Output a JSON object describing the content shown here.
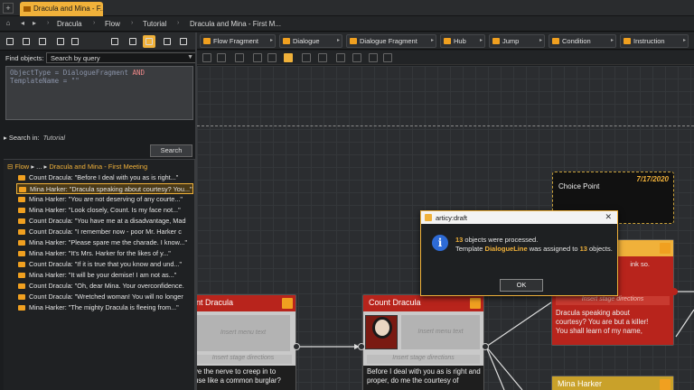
{
  "window_tab": {
    "title": "Dracula and Mina - F..."
  },
  "breadcrumb": [
    "Dracula",
    "Flow",
    "Tutorial",
    "Dracula and Mina - First M..."
  ],
  "search": {
    "find_label": "Find objects:",
    "query_type": "Search by query",
    "query_line1_a": "ObjectType = DialogueFragment ",
    "query_line1_b": "AND",
    "query_line2": "TemplateName = \"\"",
    "search_in_label": "Search in:",
    "search_in_value": "Tutorial",
    "search_button": "Search"
  },
  "results": {
    "path_a": "Flow",
    "path_b": "Dracula and Mina - First Meeting",
    "items": [
      "Count Dracula: \"Before I deal with you as is right...\"",
      "Mina Harker: \"Dracula speaking about courtesy? You...\"",
      "Mina Harker: \"You are not deserving of any courte...\"",
      "Mina Harker: \"Look closely, Count. Is my face not...\"",
      "Count Dracula: \"You have me at a disadvantage, Mad",
      "Count Dracula: \"I remember now - poor Mr. Harker c",
      "Mina Harker: \"Please spare me the charade. I know...\"",
      "Mina Harker: \"It's Mrs. Harker for the likes of y...\"",
      "Count Dracula: \"If it is true that you know and und...\"",
      "Mina Harker: \"It will be your demise! I am not as...\"",
      "Count Dracula: \"Oh, dear Mina. Your overconfidence.",
      "Count Dracula: \"Wretched woman! You will no longer",
      "Mina Harker: \"The mighty Dracula is fleeing from...\""
    ]
  },
  "template_tabs": [
    "Flow Fragment",
    "Dialogue",
    "Dialogue Fragment",
    "Hub",
    "Jump",
    "Condition",
    "Instruction"
  ],
  "canvas": {
    "node_left_title": "nt Dracula",
    "node_left_menu": "Insert menu text",
    "node_left_stage": "Insert stage directions",
    "node_left_text": "ve the nerve to creep in to\nuse like a common burglar?",
    "node_mid_title": "Count Dracula",
    "node_mid_menu": "Insert menu text",
    "node_mid_stage": "Insert stage directions",
    "node_mid_text": "Before I deal with you as is right and\nproper, do me the courtesy of",
    "node_right_partial": "ink so.",
    "node_right_stage": "Insert stage directions",
    "node_right_text": "Dracula speaking about\ncourtesy? You are but a killer!\nYou shall learn of my name,",
    "node_bottom_title": "Mina Harker",
    "choice_date": "7/17/2020",
    "choice_label": "Choice Point"
  },
  "dialog": {
    "title": "articy:draft",
    "count1": "13",
    "line1_rest": " objects were processed.",
    "line2_a": "Template ",
    "template_name": "DialogueLine",
    "line2_b": " was assigned to ",
    "count2": "13",
    "line2_c": " objects.",
    "ok_label": "OK"
  },
  "colors": {
    "accent": "#f0b13a",
    "node_header": "#b8241c",
    "info_icon": "#2e6bd6"
  }
}
